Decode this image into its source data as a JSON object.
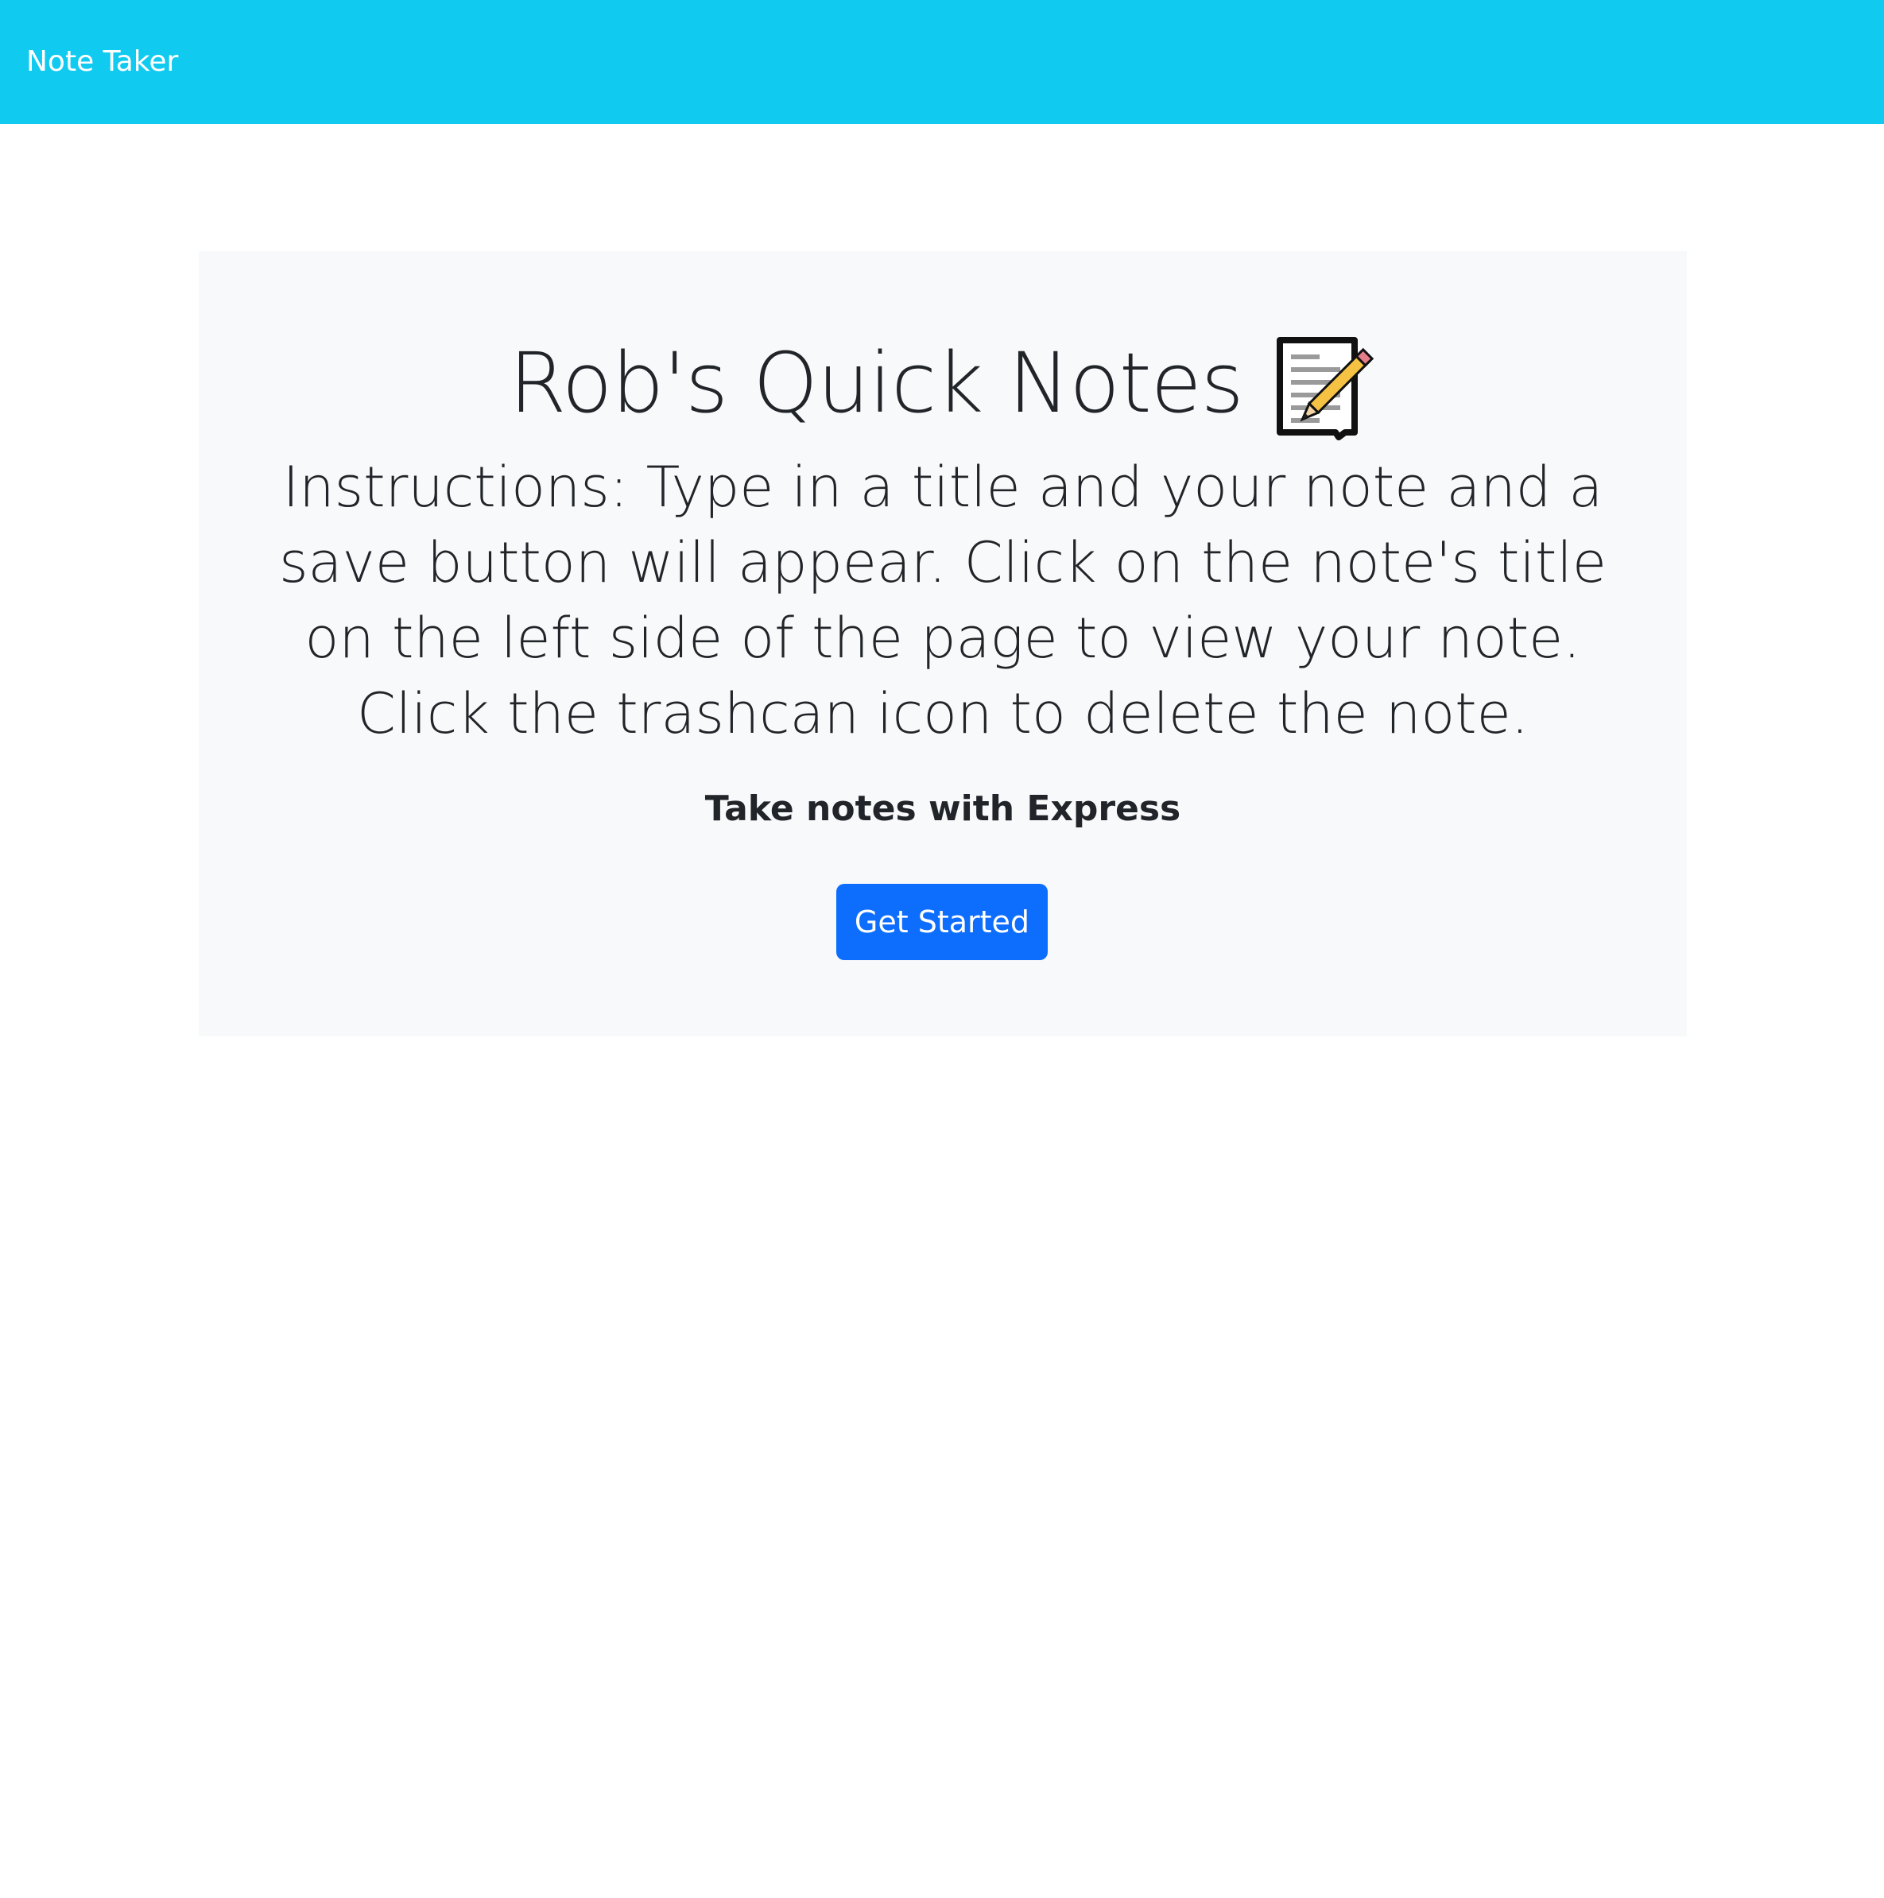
{
  "navbar": {
    "brand": "Note Taker",
    "background_color": "#11caf0"
  },
  "hero": {
    "title": "Rob's Quick Notes",
    "title_icon": "memo-icon",
    "instructions": "Instructions: Type in a title and your note and a save button will appear. Click on the note's title on the left side of the page to view your note. Click the trashcan icon to delete the note.",
    "subtitle": "Take notes with Express",
    "button_label": "Get Started",
    "button_color": "#0d6efd",
    "background_color": "#f8f9fa"
  }
}
